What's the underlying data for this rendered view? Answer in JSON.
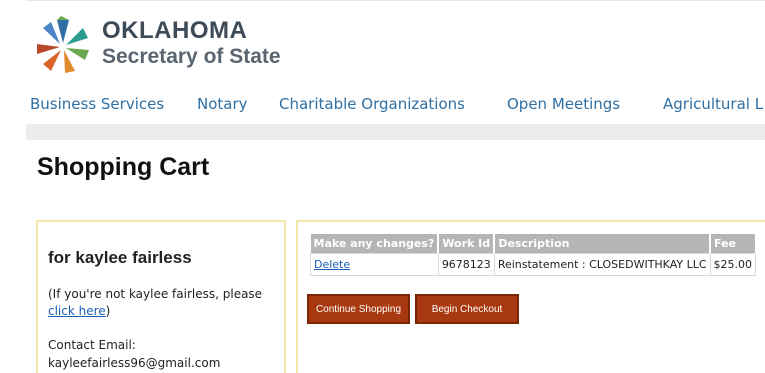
{
  "brand": {
    "line1": "OKLAHOMA",
    "line2": "Secretary of State",
    "colors": {
      "blue": "#2f6fa3",
      "green": "#6aa84f",
      "orange": "#d9652b",
      "teal": "#2a9d8f"
    }
  },
  "nav": {
    "items": [
      {
        "label": "Business Services"
      },
      {
        "label": "Notary"
      },
      {
        "label": "Charitable Organizations"
      },
      {
        "label": "Open Meetings"
      },
      {
        "label": "Agricultural L"
      }
    ]
  },
  "page": {
    "title": "Shopping Cart"
  },
  "account": {
    "name": "for kaylee fairless",
    "note_prefix": "(If you're not kaylee fairless, please ",
    "note_link": "click here",
    "note_suffix": ")",
    "email_label": "Contact Email:",
    "email": "kayleefairless96@gmail.com"
  },
  "cart": {
    "headers": [
      "Make any changes?",
      "Work Id",
      "Description",
      "Fee"
    ],
    "rows": [
      {
        "action": "Delete",
        "work_id": "9678123",
        "description": "Reinstatement : CLOSEDWITHKAY LLC",
        "fee": "$25.00"
      }
    ],
    "continue_label": "Continue Shopping",
    "checkout_label": "Begin Checkout",
    "button_color": "#a8380f"
  }
}
